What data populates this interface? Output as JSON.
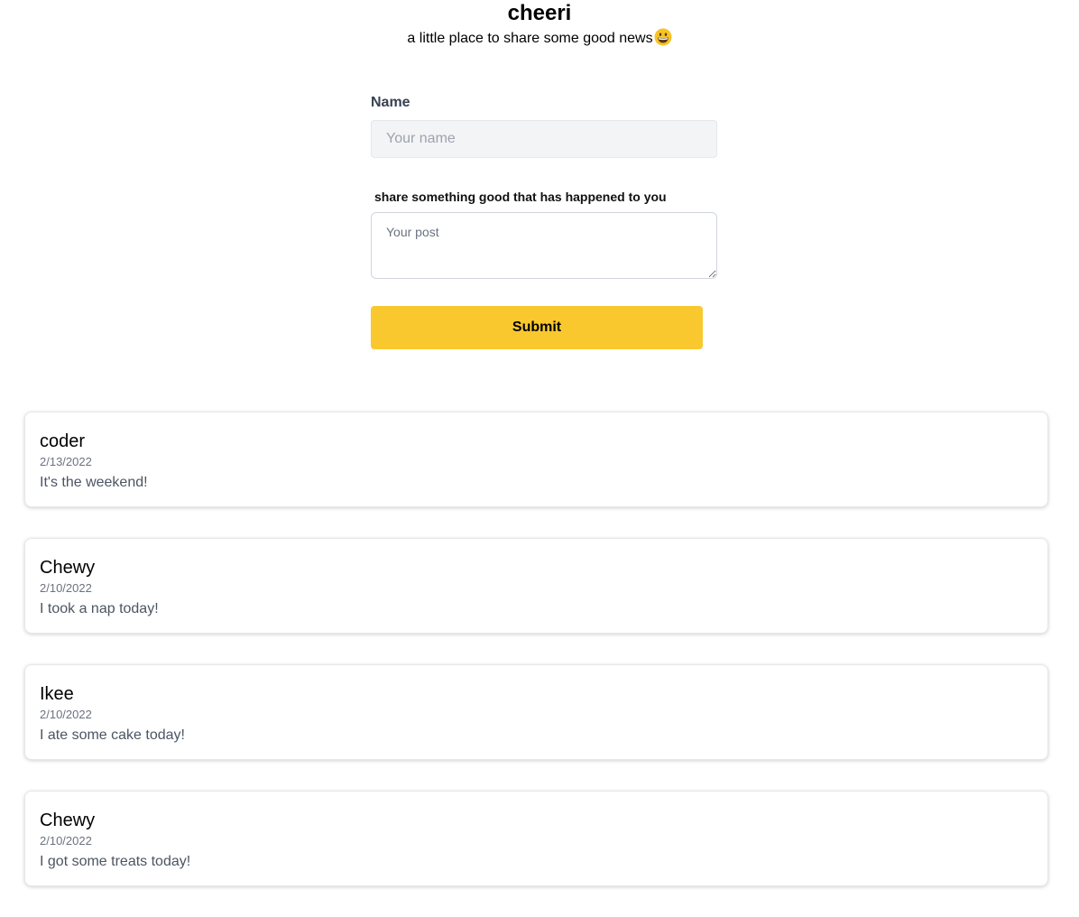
{
  "header": {
    "title": "cheeri",
    "tagline": "a little place to share some good news"
  },
  "form": {
    "name_label": "Name",
    "name_placeholder": "Your name",
    "name_value": "",
    "post_label": "share something good that has happened to you",
    "post_placeholder": "Your post",
    "post_value": "",
    "submit_label": "Submit",
    "submit_color": "#f9c82f"
  },
  "posts": [
    {
      "author": "coder",
      "date": "2/13/2022",
      "text": "It's the weekend!"
    },
    {
      "author": "Chewy",
      "date": "2/10/2022",
      "text": "I took a nap today!"
    },
    {
      "author": "Ikee",
      "date": "2/10/2022",
      "text": "I ate some cake today!"
    },
    {
      "author": "Chewy",
      "date": "2/10/2022",
      "text": "I got some treats today!"
    }
  ],
  "icons": {
    "tagline_emoji": "grinning-face-icon"
  }
}
